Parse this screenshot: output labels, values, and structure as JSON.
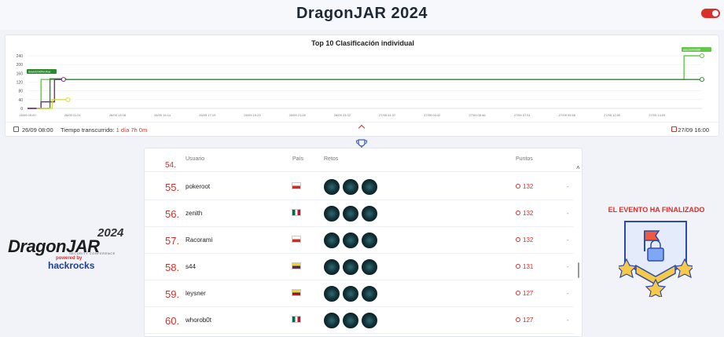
{
  "header": {
    "title": "DragonJAR 2024",
    "toggle_color": "#d9302b"
  },
  "chart": {
    "title": "Top 10 Clasificación individual",
    "start_date": "26/09 08:00",
    "elapsed_label": "Tiempo transcurrido:",
    "elapsed_value": "1 día 7h 0m",
    "end_date": "27/09 16:00",
    "legend_labels": [
      "aazzelmoldii",
      "davidchi0N/Jhar"
    ]
  },
  "chart_data": {
    "type": "line",
    "title": "Top 10 Clasificación individual",
    "xlabel": "",
    "ylabel": "",
    "yticks": [
      0,
      40,
      80,
      120,
      160,
      200,
      240
    ],
    "ylim": [
      0,
      240
    ],
    "xticks": [
      "26/09 09:00",
      "26/09 11:24",
      "26/09 13:08",
      "26/09 15:14",
      "26/09 17:19",
      "26/09 19:23",
      "26/09 21:28",
      "26/09 23:32",
      "27/09 01:37",
      "27/09 03:42",
      "27/09 05:46",
      "27/09 07:51",
      "27/09 09:55",
      "27/09 12:00",
      "27/09 14:05"
    ],
    "series": [
      {
        "name": "aazzelmoldii",
        "color": "#63c74a",
        "x": [
          0,
          0.3,
          0.3,
          0.5,
          0.5,
          14.6,
          14.6,
          15.0
        ],
        "y": [
          0,
          0,
          132,
          132,
          132,
          132,
          240,
          240
        ]
      },
      {
        "name": "davidchi0N/Jhar",
        "color": "#2c8a2c",
        "x": [
          0,
          0.5,
          0.5,
          0.85,
          0.85,
          15.0
        ],
        "y": [
          0,
          0,
          135,
          135,
          132,
          132
        ]
      },
      {
        "values_only": true,
        "color": "#7a2f82",
        "x": [
          0,
          0.3,
          0.3,
          0.6,
          0.6,
          0.8
        ],
        "y": [
          0,
          0,
          30,
          30,
          132,
          132
        ]
      },
      {
        "values_only": true,
        "color": "#d7d94a",
        "x": [
          0.2,
          0.55,
          0.55,
          0.9
        ],
        "y": [
          0,
          0,
          40,
          40
        ]
      }
    ]
  },
  "table": {
    "headers": {
      "user": "Usuario",
      "country": "País",
      "challenges": "Retos",
      "points": "Puntos"
    },
    "cut_rank": "54.",
    "rows": [
      {
        "rank": "55.",
        "user": "pokeroot",
        "flag": "chile",
        "points": "132",
        "extra": "-"
      },
      {
        "rank": "56.",
        "user": "zenith",
        "flag": "mexico",
        "points": "132",
        "extra": "-"
      },
      {
        "rank": "57.",
        "user": "Racorami",
        "flag": "chile",
        "points": "132",
        "extra": "-"
      },
      {
        "rank": "58.",
        "user": "s44",
        "flag": "colombia",
        "points": "131",
        "extra": "-"
      },
      {
        "rank": "59.",
        "user": "leysner",
        "flag": "colombia",
        "points": "127",
        "extra": "-"
      },
      {
        "rank": "60.",
        "user": "whorob0t",
        "flag": "mexico",
        "points": "127",
        "extra": "-"
      }
    ]
  },
  "logo": {
    "year": "2024",
    "word": "DragonJAR",
    "subtitle": "SECURITY CONFERENCE",
    "powered": "powered by",
    "sponsor": "hackrocks"
  },
  "event": {
    "status": "EL EVENTO HA FINALIZADO"
  },
  "icons": [
    "calendar-icon",
    "chevron-up-icon",
    "trophy-icon",
    "points-icon",
    "medal-icon",
    "toggle-switch"
  ]
}
